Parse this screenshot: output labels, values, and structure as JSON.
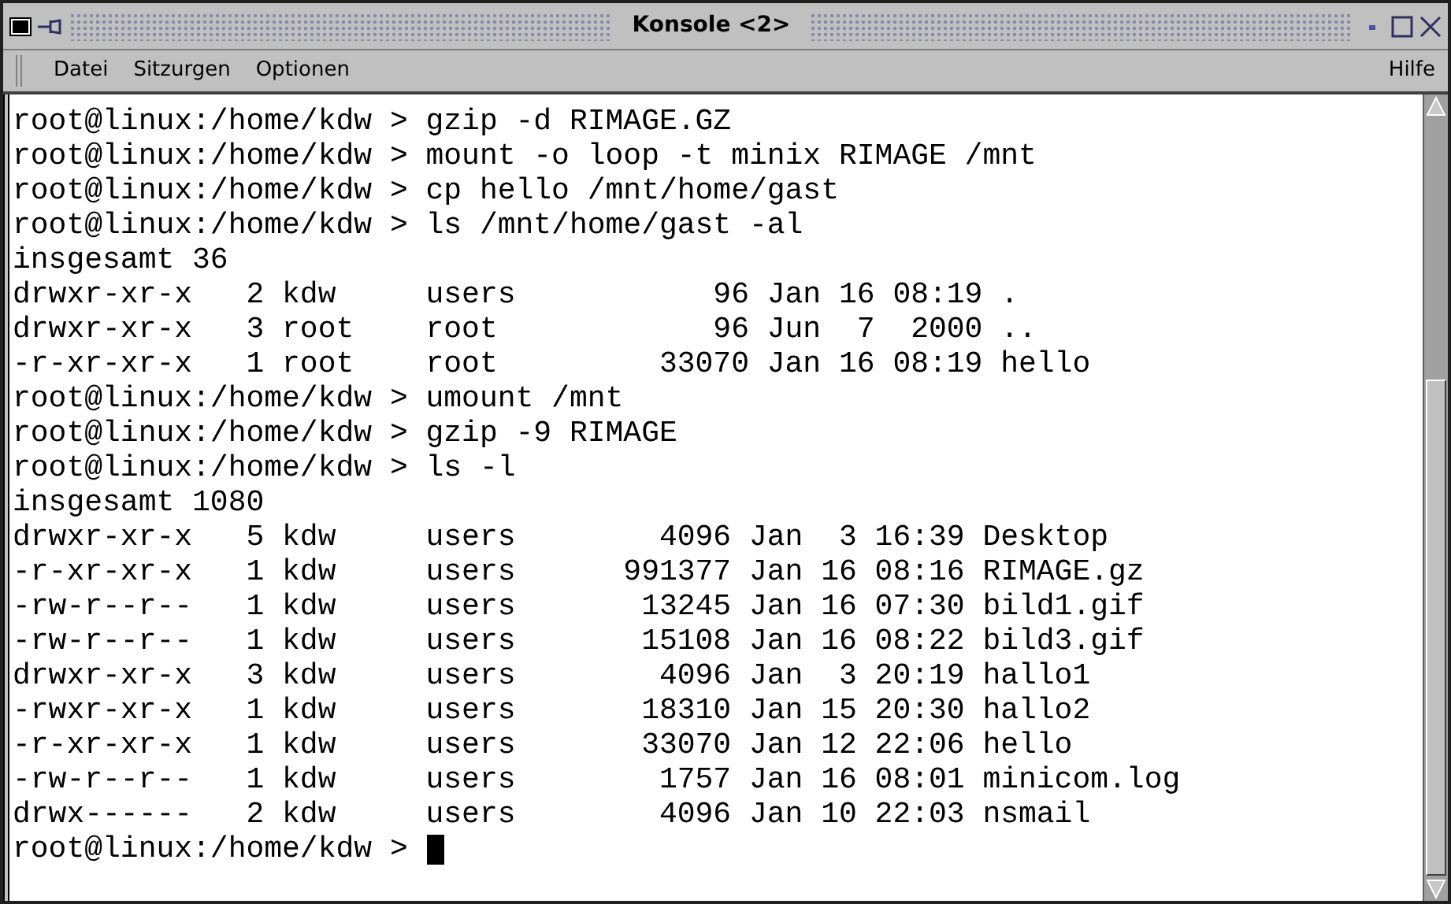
{
  "window": {
    "title": "Konsole <2>"
  },
  "menu": {
    "items": [
      "Datei",
      "Sitzurgen",
      "Optionen"
    ],
    "help": "Hilfe"
  },
  "terminal": {
    "lines": [
      "root@linux:/home/kdw > gzip -d RIMAGE.GZ",
      "root@linux:/home/kdw > mount -o loop -t minix RIMAGE /mnt",
      "root@linux:/home/kdw > cp hello /mnt/home/gast",
      "root@linux:/home/kdw > ls /mnt/home/gast -al",
      "insgesamt 36",
      "drwxr-xr-x   2 kdw     users           96 Jan 16 08:19 .",
      "drwxr-xr-x   3 root    root            96 Jun  7  2000 ..",
      "-r-xr-xr-x   1 root    root         33070 Jan 16 08:19 hello",
      "root@linux:/home/kdw > umount /mnt",
      "root@linux:/home/kdw > gzip -9 RIMAGE",
      "root@linux:/home/kdw > ls -l",
      "insgesamt 1080",
      "drwxr-xr-x   5 kdw     users        4096 Jan  3 16:39 Desktop",
      "-r-xr-xr-x   1 kdw     users      991377 Jan 16 08:16 RIMAGE.gz",
      "-rw-r--r--   1 kdw     users       13245 Jan 16 07:30 bild1.gif",
      "-rw-r--r--   1 kdw     users       15108 Jan 16 08:22 bild3.gif",
      "drwxr-xr-x   3 kdw     users        4096 Jan  3 20:19 hallo1",
      "-rwxr-xr-x   1 kdw     users       18310 Jan 15 20:30 hallo2",
      "-r-xr-xr-x   1 kdw     users       33070 Jan 12 22:06 hello",
      "-rw-r--r--   1 kdw     users        1757 Jan 16 08:01 minicom.log",
      "drwx------   2 kdw     users        4096 Jan 10 22:03 nsmail"
    ],
    "prompt": "root@linux:/home/kdw >"
  }
}
